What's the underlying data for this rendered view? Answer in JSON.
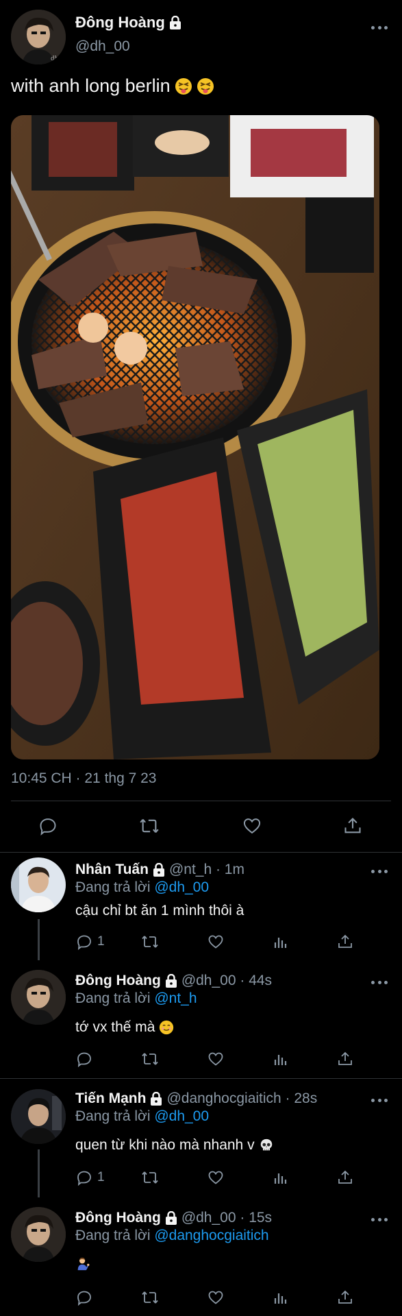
{
  "main_tweet": {
    "author_name": "Đông Hoàng",
    "author_handle": "@dh_00",
    "text": "with anh long berlin",
    "text_emojis": [
      "squinting-face-with-tongue-emoji",
      "squinting-face-with-tongue-emoji"
    ],
    "timestamp": "10:45 CH · 21 thg 7 23",
    "photo_alt": "photo",
    "actions": [
      "reply-icon",
      "retweet-icon",
      "like-icon",
      "share-icon"
    ]
  },
  "replies": [
    {
      "author_name": "Nhân Tuấn",
      "handle_time": "@nt_h · 1m",
      "replying_label": "Đang trả lời",
      "replying_to": "@dh_00",
      "text": "cậu chỉ bt ăn 1 mình thôi à",
      "emoji": "",
      "reply_count": "1"
    },
    {
      "author_name": "Đông Hoàng",
      "handle_time": "@dh_00 · 44s",
      "replying_label": "Đang trả lời",
      "replying_to": "@nt_h",
      "text": "tớ vx thế mà",
      "emoji": "smiling-face-emoji",
      "reply_count": ""
    },
    {
      "author_name": "Tiến Mạnh",
      "handle_time": "@danghocgiaitich · 28s",
      "replying_label": "Đang trả lời",
      "replying_to": "@dh_00",
      "text": "quen từ khi nào mà nhanh v",
      "emoji": "skull-emoji",
      "reply_count": "1"
    },
    {
      "author_name": "Đông Hoàng",
      "handle_time": "@dh_00 · 15s",
      "replying_label": "Đang trả lời",
      "replying_to": "@danghocgiaitich",
      "text": "",
      "emoji": "person-tipping-hand-emoji",
      "reply_count": ""
    }
  ],
  "colors": {
    "background": "#000000",
    "text": "#e7e9ea",
    "muted": "#8b98a5",
    "link": "#1d9bf0",
    "divider": "#2f3336"
  }
}
